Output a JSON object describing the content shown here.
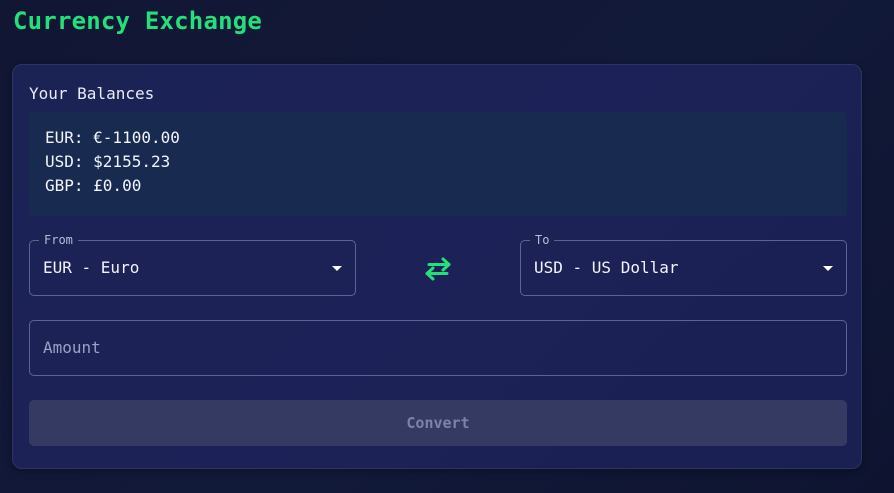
{
  "app": {
    "title": "Currency Exchange"
  },
  "balances": {
    "title": "Your Balances",
    "items": [
      "EUR: €-1100.00",
      "USD: $2155.23",
      "GBP: £0.00"
    ]
  },
  "from": {
    "label": "From",
    "value": "EUR - Euro",
    "icon": "chevron-down-icon"
  },
  "to": {
    "label": "To",
    "value": "USD - US Dollar",
    "icon": "chevron-down-icon"
  },
  "swap": {
    "icon": "swap-arrows-icon",
    "color": "#22e07a"
  },
  "amount": {
    "placeholder": "Amount",
    "value": ""
  },
  "convert": {
    "label": "Convert",
    "state": "disabled"
  },
  "colors": {
    "accent": "#22e07a",
    "background": "#111633",
    "card": "#1b2354",
    "balances_box": "#182a4f",
    "button_disabled": "#343a62"
  }
}
